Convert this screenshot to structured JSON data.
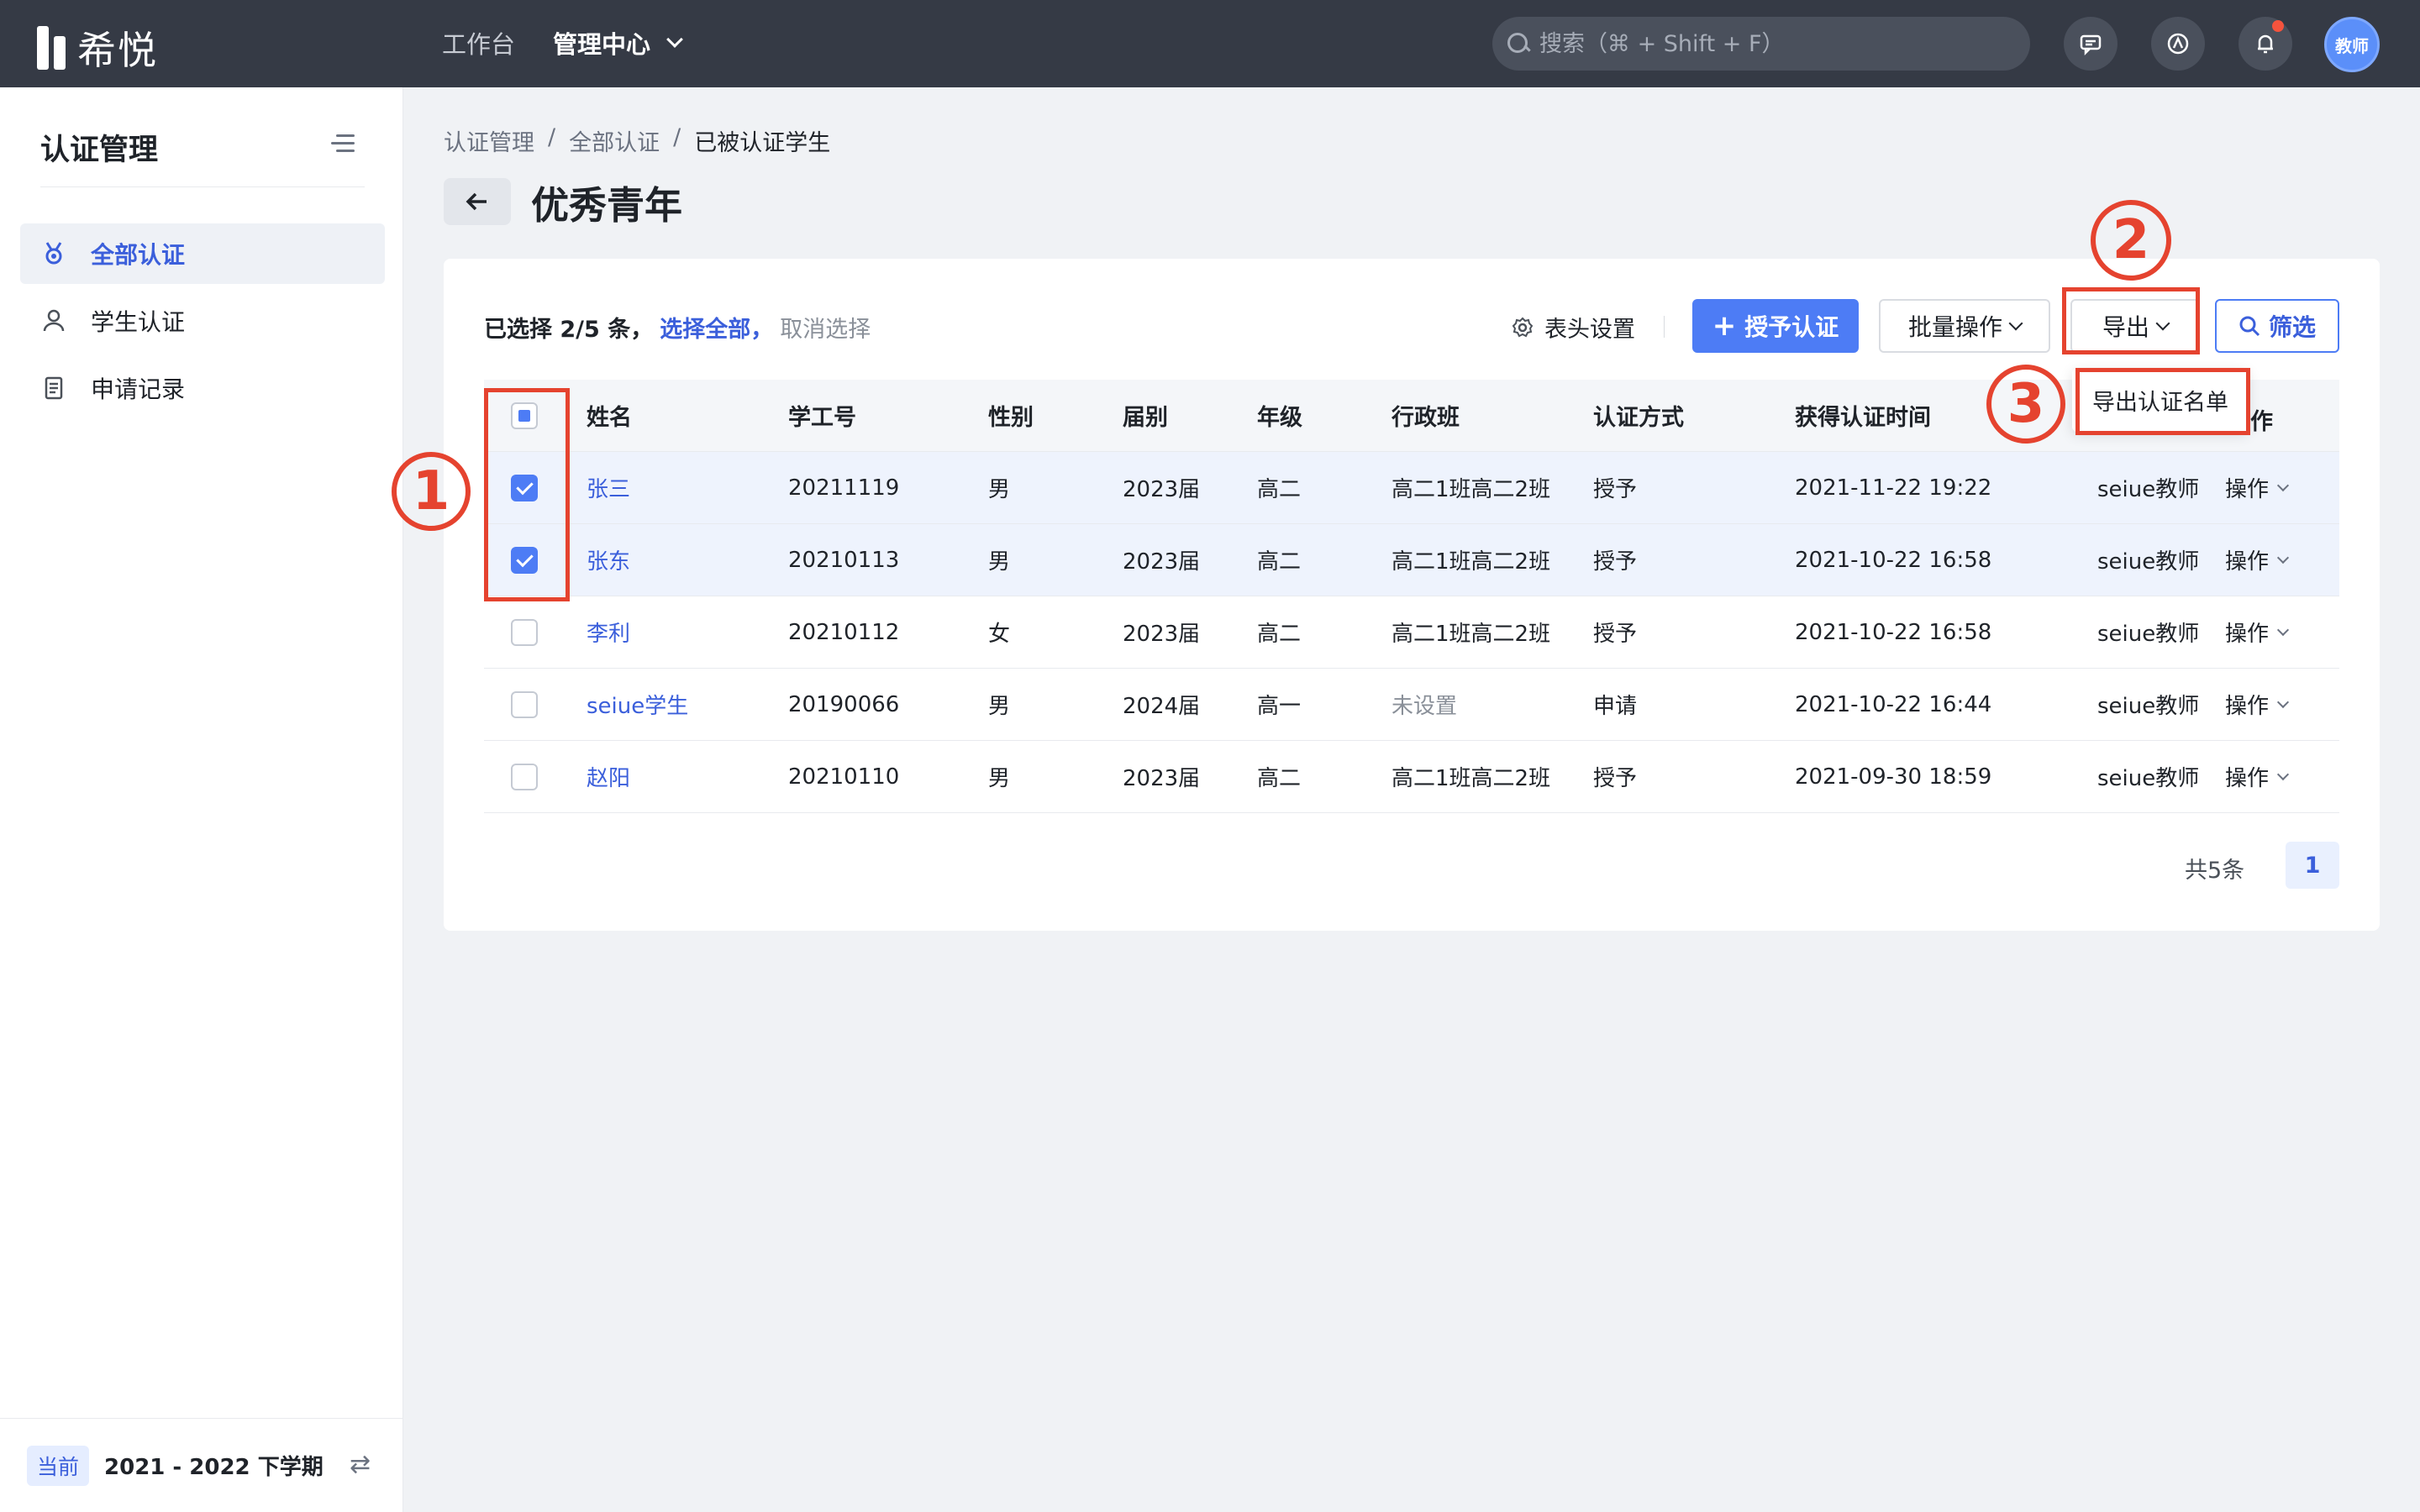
{
  "app": {
    "logo_text": "希悦",
    "nav": {
      "workbench": "工作台",
      "admin": "管理中心"
    },
    "search_placeholder": "搜索（⌘ + Shift + F）",
    "avatar": "教师"
  },
  "sidebar": {
    "title": "认证管理",
    "items": [
      {
        "label": "全部认证",
        "icon": "medal-icon",
        "active": true
      },
      {
        "label": "学生认证",
        "icon": "person-icon",
        "active": false
      },
      {
        "label": "申请记录",
        "icon": "document-icon",
        "active": false
      }
    ],
    "footer": {
      "badge": "当前",
      "term": "2021 - 2022 下学期"
    }
  },
  "breadcrumb": [
    "认证管理",
    "全部认证",
    "已被认证学生"
  ],
  "breadcrumb_sep": "/",
  "page_title": "优秀青年",
  "toolbar": {
    "selection_count": "已选择 2/5 条，",
    "select_all": "选择全部，",
    "cancel_selection": "取消选择",
    "header_settings": "表头设置",
    "grant": "授予认证",
    "batch": "批量操作",
    "export": "导出",
    "filter": "筛选"
  },
  "export_menu": {
    "item": "导出认证名单"
  },
  "table": {
    "headers": [
      "姓名",
      "学工号",
      "性别",
      "届别",
      "年级",
      "行政班",
      "认证方式",
      "获得认证时间",
      "作"
    ],
    "rows": [
      {
        "selected": true,
        "name": "张三",
        "id": "20211119",
        "sex": "男",
        "grad": "2023届",
        "grade": "高二",
        "cls": "高二1班高二2班",
        "way": "授予",
        "time": "2021-11-22 19:22",
        "teacher": "seiue教师",
        "op": "操作"
      },
      {
        "selected": true,
        "name": "张东",
        "id": "20210113",
        "sex": "男",
        "grad": "2023届",
        "grade": "高二",
        "cls": "高二1班高二2班",
        "way": "授予",
        "time": "2021-10-22 16:58",
        "teacher": "seiue教师",
        "op": "操作"
      },
      {
        "selected": false,
        "name": "李利",
        "id": "20210112",
        "sex": "女",
        "grad": "2023届",
        "grade": "高二",
        "cls": "高二1班高二2班",
        "way": "授予",
        "time": "2021-10-22 16:58",
        "teacher": "seiue教师",
        "op": "操作"
      },
      {
        "selected": false,
        "name": "seiue学生",
        "id": "20190066",
        "sex": "男",
        "grad": "2024届",
        "grade": "高一",
        "cls": "未设置",
        "way": "申请",
        "time": "2021-10-22 16:44",
        "teacher": "seiue教师",
        "op": "操作"
      },
      {
        "selected": false,
        "name": "赵阳",
        "id": "20210110",
        "sex": "男",
        "grad": "2023届",
        "grade": "高二",
        "cls": "高二1班高二2班",
        "way": "授予",
        "time": "2021-09-30 18:59",
        "teacher": "seiue教师",
        "op": "操作"
      }
    ]
  },
  "pagination": {
    "total": "共5条",
    "current": "1"
  },
  "annotations": {
    "one": "1",
    "two": "2",
    "three": "3"
  },
  "colors": {
    "accent": "#4d7cf5",
    "annotation": "#e5432f",
    "topbar": "#353a45"
  }
}
